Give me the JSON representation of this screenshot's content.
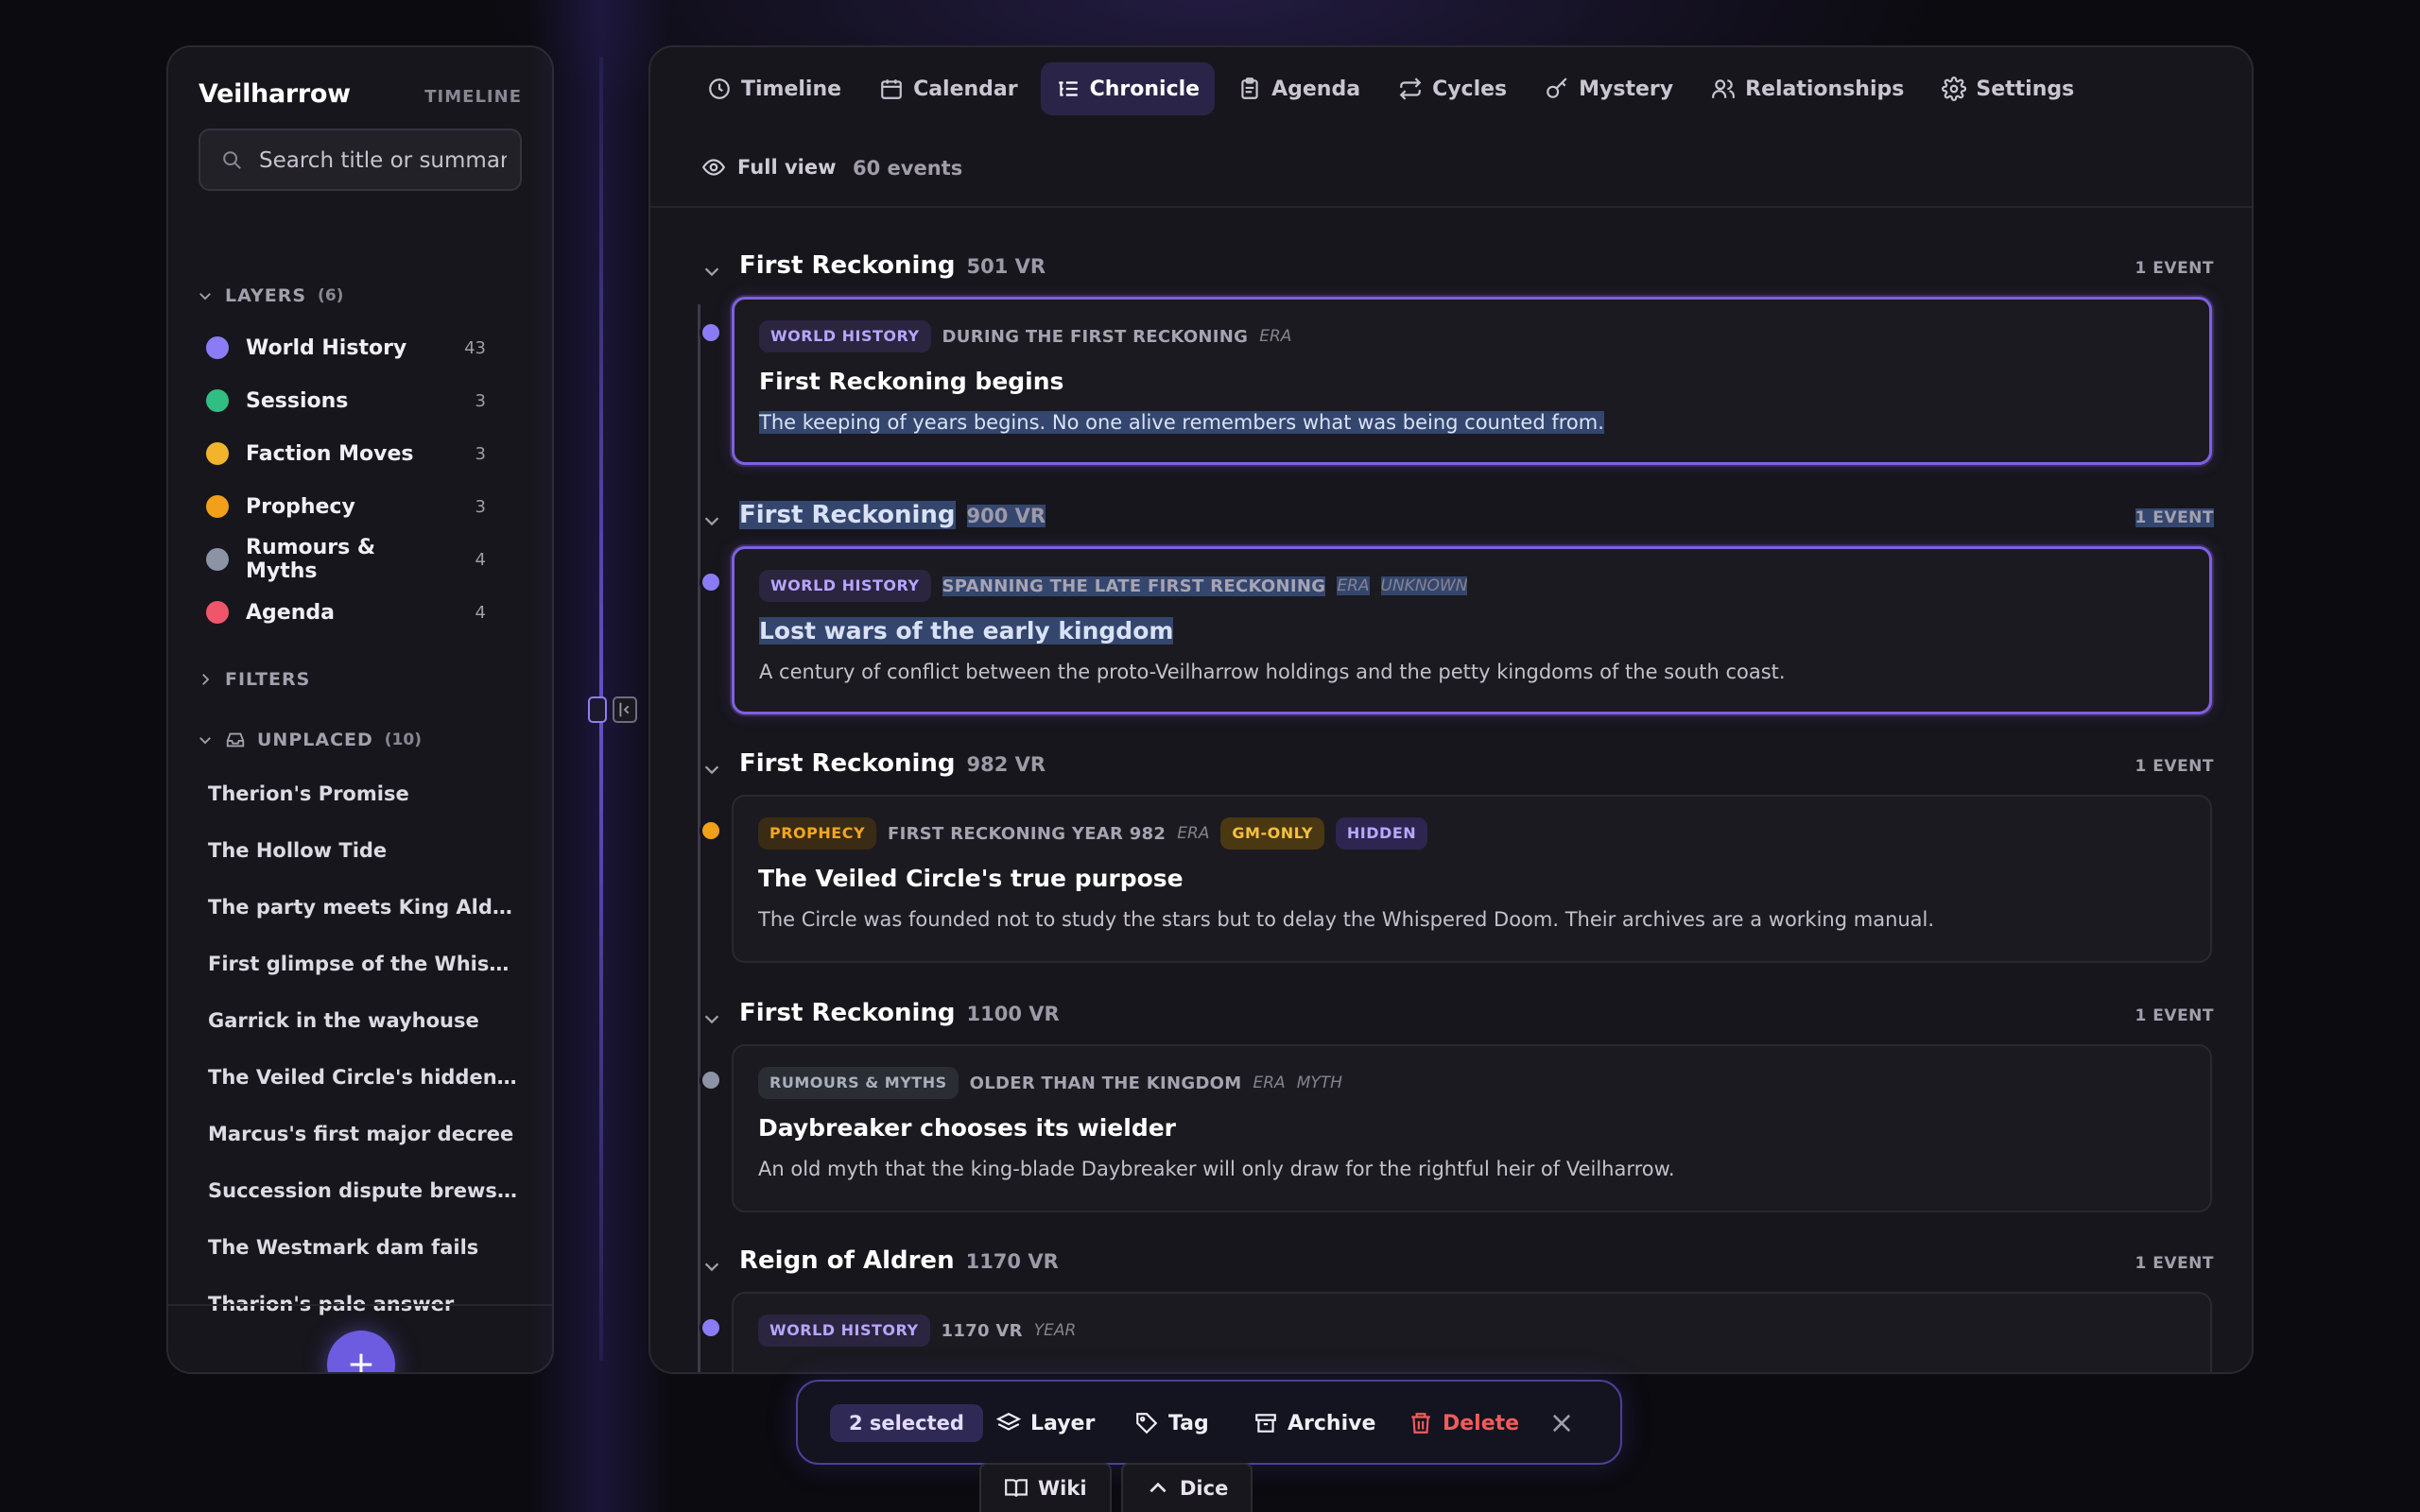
{
  "app": {
    "name": "Veilharrow",
    "subtitle": "TIMELINE"
  },
  "search": {
    "placeholder": "Search title or summary"
  },
  "layers": {
    "label": "LAYERS",
    "count": "(6)",
    "items": [
      {
        "name": "World History",
        "count": "43",
        "color": "#8b7cf6"
      },
      {
        "name": "Sessions",
        "count": "3",
        "color": "#2fbf83"
      },
      {
        "name": "Faction Moves",
        "count": "3",
        "color": "#f2b42a"
      },
      {
        "name": "Prophecy",
        "count": "3",
        "color": "#f29f1a"
      },
      {
        "name": "Rumours & Myths",
        "count": "4",
        "color": "#8b93a5"
      },
      {
        "name": "Agenda",
        "count": "4",
        "color": "#f0566b"
      }
    ]
  },
  "filters": {
    "label": "FILTERS"
  },
  "unplaced": {
    "label": "UNPLACED",
    "count": "(10)",
    "items": [
      "Therion's Promise",
      "The Hollow Tide",
      "The party meets King Aldren",
      "First glimpse of the Whispered Doom",
      "Garrick in the wayhouse",
      "The Veiled Circle's hidden archive",
      "Marcus's first major decree",
      "Succession dispute brews in the capital",
      "The Westmark dam fails",
      "Tharion's pale answer"
    ]
  },
  "fab": {
    "label": "+"
  },
  "tabs": [
    {
      "label": "Timeline",
      "icon": "clock-icon"
    },
    {
      "label": "Calendar",
      "icon": "calendar-icon"
    },
    {
      "label": "Chronicle",
      "icon": "list-icon",
      "active": true
    },
    {
      "label": "Agenda",
      "icon": "clipboard-icon"
    },
    {
      "label": "Cycles",
      "icon": "repeat-icon"
    },
    {
      "label": "Mystery",
      "icon": "key-icon"
    },
    {
      "label": "Relationships",
      "icon": "users-icon"
    },
    {
      "label": "Settings",
      "icon": "gear-icon"
    }
  ],
  "toolbar": {
    "view": "Full view",
    "count": "60 events"
  },
  "groups": [
    {
      "name": "First Reckoning",
      "year": "501 VR",
      "count": "1 EVENT",
      "highlight": false,
      "event": {
        "layer": "WORLD HISTORY",
        "layer_style": "wh",
        "dot": "#8b7cf6",
        "when": "DURING THE FIRST RECKONING",
        "precision": [
          "ERA"
        ],
        "badges": [],
        "title": "First Reckoning begins",
        "desc": "The keeping of years begins. No one alive remembers what was being counted from.",
        "selected": true,
        "hl_title": false,
        "hl_desc": true,
        "hl_meta": false
      }
    },
    {
      "name": "First Reckoning",
      "year": "900 VR",
      "count": "1 EVENT",
      "highlight": true,
      "event": {
        "layer": "WORLD HISTORY",
        "layer_style": "wh",
        "dot": "#8b7cf6",
        "when": "SPANNING THE LATE FIRST RECKONING",
        "precision": [
          "ERA",
          "UNKNOWN"
        ],
        "badges": [],
        "title": "Lost wars of the early kingdom",
        "desc": "A century of conflict between the proto-Veilharrow holdings and the petty kingdoms of the south coast.",
        "selected": true,
        "hl_title": true,
        "hl_desc": false,
        "hl_meta": true
      }
    },
    {
      "name": "First Reckoning",
      "year": "982 VR",
      "count": "1 EVENT",
      "highlight": false,
      "event": {
        "layer": "PROPHECY",
        "layer_style": "pr",
        "dot": "#f29f1a",
        "when": "FIRST RECKONING YEAR 982",
        "precision": [
          "ERA"
        ],
        "badges": [
          {
            "label": "GM-ONLY",
            "style": "gm"
          },
          {
            "label": "HIDDEN",
            "style": "hid"
          }
        ],
        "title": "The Veiled Circle's true purpose",
        "desc": "The Circle was founded not to study the stars but to delay the Whispered Doom. Their archives are a working manual.",
        "selected": false,
        "hl_title": false,
        "hl_desc": false,
        "hl_meta": false
      }
    },
    {
      "name": "First Reckoning",
      "year": "1100 VR",
      "count": "1 EVENT",
      "highlight": false,
      "event": {
        "layer": "RUMOURS & MYTHS",
        "layer_style": "rm",
        "dot": "#8b93a5",
        "when": "OLDER THAN THE KINGDOM",
        "precision": [
          "ERA",
          "MYTH"
        ],
        "badges": [],
        "title": "Daybreaker chooses its wielder",
        "desc": "An old myth that the king-blade Daybreaker will only draw for the rightful heir of Veilharrow.",
        "selected": false,
        "hl_title": false,
        "hl_desc": false,
        "hl_meta": false
      }
    },
    {
      "name": "Reign of Aldren",
      "year": "1170 VR",
      "count": "1 EVENT",
      "highlight": false,
      "event": {
        "layer": "WORLD HISTORY",
        "layer_style": "wh",
        "dot": "#8b7cf6",
        "when": "1170 VR",
        "precision": [
          "YEAR"
        ],
        "badges": [],
        "title": "",
        "desc": "",
        "selected": false,
        "hl_title": false,
        "hl_desc": false,
        "hl_meta": false
      }
    }
  ],
  "actionbar": {
    "selected": "2 selected",
    "layer": "Layer",
    "tag": "Tag",
    "archive": "Archive",
    "delete": "Delete"
  },
  "dock": {
    "wiki": "Wiki",
    "dice": "Dice"
  },
  "colors": {
    "accent": "#6d5ce0",
    "danger": "#f25b5b",
    "selection": "#8060e0"
  }
}
